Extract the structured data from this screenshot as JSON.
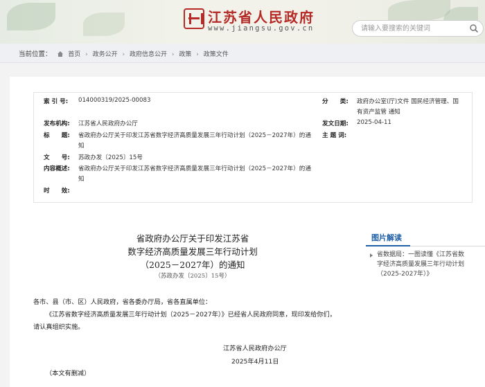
{
  "header": {
    "site_title": "江苏省人民政府",
    "site_url": "www.jiangsu.gov.cn",
    "search_placeholder": "请输入要搜索的关键词"
  },
  "breadcrumb": {
    "label": "当前位置：",
    "items": [
      "首页",
      "政务公开",
      "政府信息公开",
      "政策",
      "政策文件"
    ]
  },
  "meta": {
    "index_key": "索 引 号:",
    "index_val": "014000319/2025-00083",
    "category_key": "分　　类:",
    "category_val": "政府办公室(厅)文件 国民经济管理、国有资产监管 通知",
    "org_key": "发布机构:",
    "org_val": "江苏省人民政府办公厅",
    "date_key": "发文日期:",
    "date_val": "2025-04-11",
    "title_key": "标　　题:",
    "title_val": "省政府办公厅关于印发江苏省数字经济高质量发展三年行动计划（2025－2027年）的通知",
    "subject_key": "主 题 词:",
    "subject_val": "",
    "docno_key": "文　　号:",
    "docno_val": "苏政办发〔2025〕15号",
    "summary_key": "内容概述:",
    "summary_val": "省政府办公厅关于印发江苏省数字经济高质量发展三年行动计划（2025－2027年）的通知",
    "time_key": "时　　效:",
    "time_val": ""
  },
  "document": {
    "title_line1": "省政府办公厅关于印发江苏省",
    "title_line2": "数字经济高质量发展三年行动计划",
    "title_line3": "（2025－2027年）的通知",
    "doc_number": "（苏政办发〔2025〕15号）",
    "addressee": "各市、县（市、区）人民政府，省各委办厅局，省各直属单位：",
    "para1_line1": "《江苏省数字经济高质量发展三年行动计划（2025－2027年）》已经省人民政府同意，现印发给你们，",
    "para1_line2": "请认真组织实施。",
    "signer": "江苏省人民政府办公厅",
    "sign_date": "2025年4月11日",
    "note": "（本文有删减）"
  },
  "sidebar": {
    "title": "图片解读",
    "item": "省数据局：一图读懂《江苏省数字经济高质量发展三年行动计划（2025-2027年）》"
  },
  "colors": {
    "brand_red": "#b52a26",
    "accent_blue": "#1f5fa8"
  }
}
